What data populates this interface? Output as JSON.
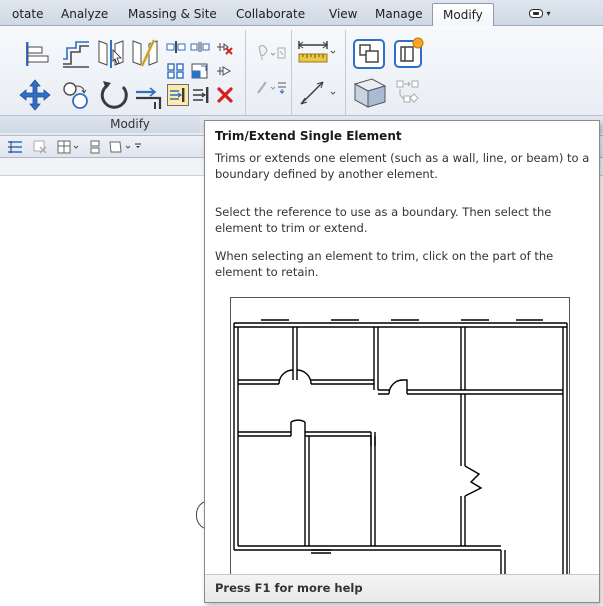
{
  "ribbon": {
    "tabs": [
      {
        "label": "otate",
        "active": false
      },
      {
        "label": "Analyze",
        "active": false
      },
      {
        "label": "Massing & Site",
        "active": false
      },
      {
        "label": "Collaborate",
        "active": false
      },
      {
        "label": "View",
        "active": false
      },
      {
        "label": "Manage",
        "active": false
      },
      {
        "label": "Modify",
        "active": true
      }
    ],
    "panel_label": "Modify",
    "tools": [
      "align-icon",
      "offset-icon",
      "mirror-pick-axis-icon",
      "mirror-draw-axis-icon",
      "move-icon",
      "copy-icon",
      "rotate-icon",
      "trim-extend-corner-icon",
      "split-element-icon",
      "array-icon",
      "scale-icon",
      "pin-icon",
      "unpin-icon",
      "trim-extend-single-icon",
      "trim-extend-multiple-icon",
      "delete-icon",
      "measure-icon",
      "dimension-icon",
      "create-group-icon",
      "create-assembly-icon",
      "hide-in-view-icon",
      "override-graphics-icon"
    ]
  },
  "tooltip": {
    "title": "Trim/Extend Single Element",
    "p1": "Trims or extends one element (such as a wall, line, or beam) to a boundary defined by another element.",
    "p2": "Select the reference to use as a boundary. Then select the element to trim or extend.",
    "p3": "When selecting an element to trim, click on the part of the element to retain.",
    "footer": "Press F1 for more help"
  },
  "colors": {
    "ribbon_bg": "#e6ebf2",
    "accent_blue": "#2f6fc4",
    "delete_red": "#d42020",
    "highlight_yellow": "#e8c64a"
  }
}
